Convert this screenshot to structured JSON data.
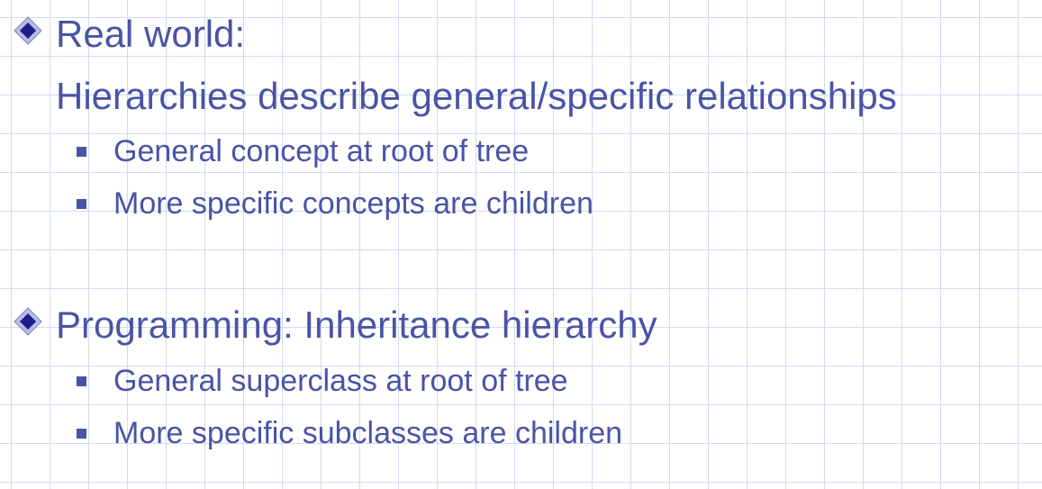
{
  "slide": {
    "items": [
      {
        "text": "Real world:",
        "continuation": "Hierarchies describe general/specific relationships",
        "children": [
          "General concept at root of tree",
          "More specific concepts are children"
        ]
      },
      {
        "text": "Programming: Inheritance hierarchy",
        "children": [
          "General superclass at root of tree",
          "More specific subclasses are children"
        ]
      }
    ]
  },
  "colors": {
    "text": "#4a53a6",
    "bullet_diamond": "#1a1f8a",
    "grid": "#cfdcef"
  },
  "icons": {
    "level1_bullet": "diamond-bullet-icon",
    "level2_bullet": "square-bullet-icon"
  }
}
